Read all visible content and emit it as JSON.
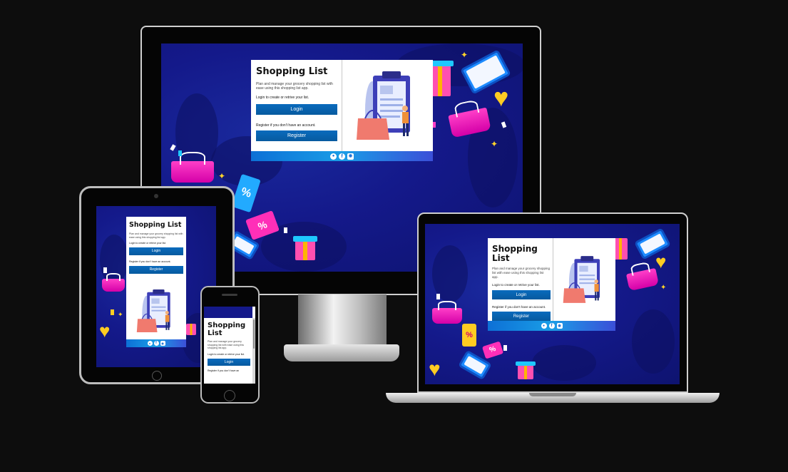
{
  "app": {
    "title": "Shopping List",
    "title_line1": "Shopping",
    "title_line2": "List",
    "description": "Plan and manage your grocery shopping list with ease using this shopping list app.",
    "login_prompt": "Login to create or retrive your list.",
    "login_label": "Login",
    "register_prompt": "Register if you don't have an account.",
    "register_prompt_truncated": "Register if you don't have an",
    "register_label": "Register"
  },
  "footer": {
    "icons": [
      "github-icon",
      "facebook-icon",
      "instagram-icon"
    ]
  },
  "deco": {
    "percent": "%"
  },
  "colors": {
    "page_bg": "#0d0d0d",
    "screen_bg": "#14198a",
    "button": "#0a6bbd",
    "footer": "#1a9de6",
    "accent_pink": "#ff3fc8",
    "accent_yellow": "#ffcc22"
  }
}
